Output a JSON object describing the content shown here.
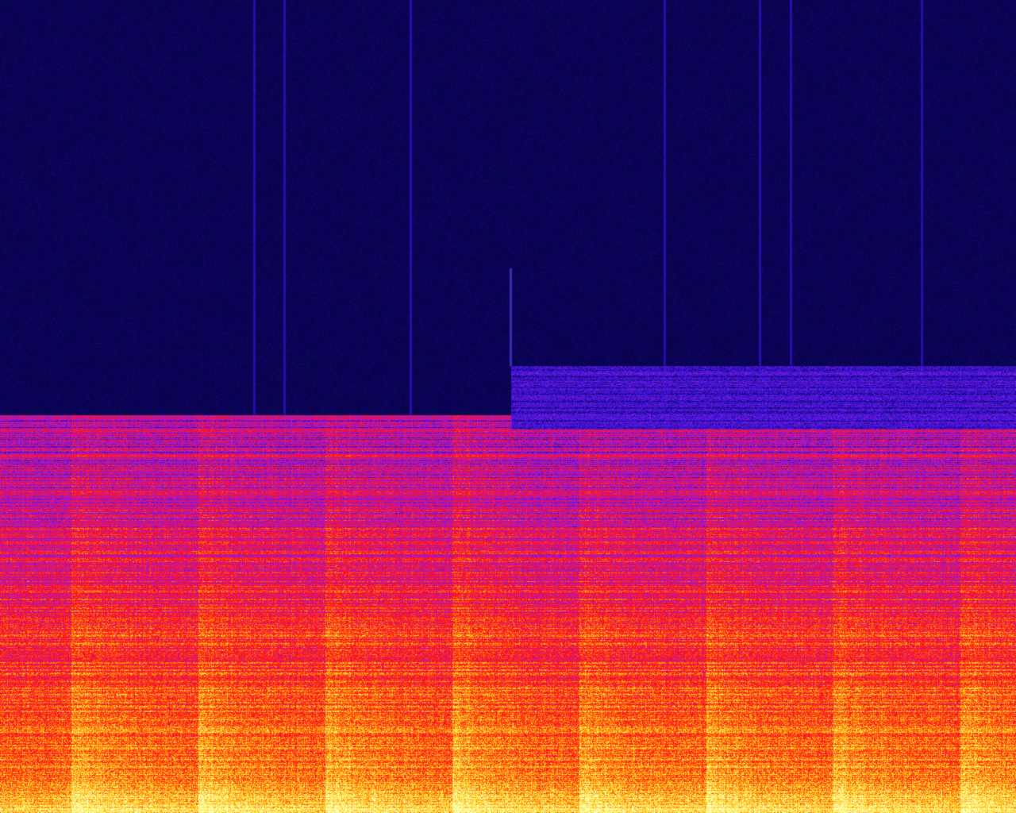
{
  "image": {
    "kind": "spectrogram",
    "description_visible_text": "",
    "colormap": [
      "#000030",
      "#1a0a8c",
      "#3a12d8",
      "#6a1ae0",
      "#b018d0",
      "#e0106a",
      "#ff1010",
      "#ff4a10",
      "#ffb010",
      "#ffe840",
      "#ffffc0"
    ],
    "background_color": "#000030",
    "left_section": {
      "time_fraction": [
        0.0,
        0.503
      ],
      "cutoff_fraction": 0.49
    },
    "right_section": {
      "time_fraction": [
        0.503,
        1.0
      ],
      "cutoff_fraction": 0.472,
      "upper_band_fraction": 0.55
    },
    "transient_time_fractions": [
      0.07,
      0.195,
      0.32,
      0.445,
      0.57,
      0.695,
      0.82,
      0.945
    ],
    "faint_vertical_line_fractions": [
      0.25,
      0.28,
      0.404,
      0.654,
      0.748,
      0.778,
      0.907
    ]
  }
}
